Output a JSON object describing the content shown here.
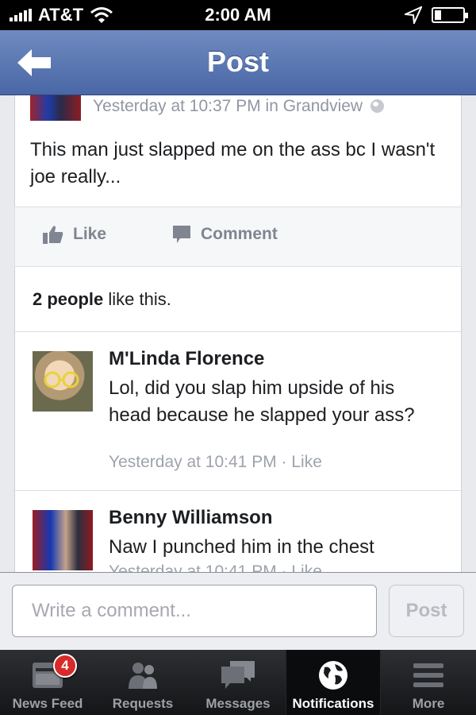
{
  "status_bar": {
    "carrier": "AT&T",
    "time": "2:00 AM"
  },
  "nav": {
    "title": "Post",
    "back_icon": "arrow-left-icon"
  },
  "post": {
    "meta": "Yesterday at 10:37 PM in Grandview",
    "text": "This man just slapped me on the ass bc I wasn't joe really...",
    "like_label": "Like",
    "comment_label": "Comment",
    "likes_count": "2 people",
    "likes_suffix": " like this."
  },
  "comments": [
    {
      "author": "M'Linda Florence",
      "text": "Lol, did you slap him upside of his head because he slapped your ass?",
      "meta": "Yesterday at 10:41 PM · Like"
    },
    {
      "author": "Benny Williamson",
      "text": "Naw I punched him in the chest",
      "meta": "Yesterday at 10:41 PM · Like"
    }
  ],
  "compose": {
    "placeholder": "Write a comment...",
    "post_label": "Post"
  },
  "tabs": [
    {
      "label": "News Feed",
      "icon": "news-feed-icon",
      "badge": "4"
    },
    {
      "label": "Requests",
      "icon": "requests-icon"
    },
    {
      "label": "Messages",
      "icon": "messages-icon"
    },
    {
      "label": "Notifications",
      "icon": "globe-icon",
      "selected": true
    },
    {
      "label": "More",
      "icon": "menu-icon"
    }
  ],
  "colors": {
    "nav_blue": "#4a67a6",
    "badge_red": "#d92a2a",
    "meta_gray": "#9197a3"
  }
}
